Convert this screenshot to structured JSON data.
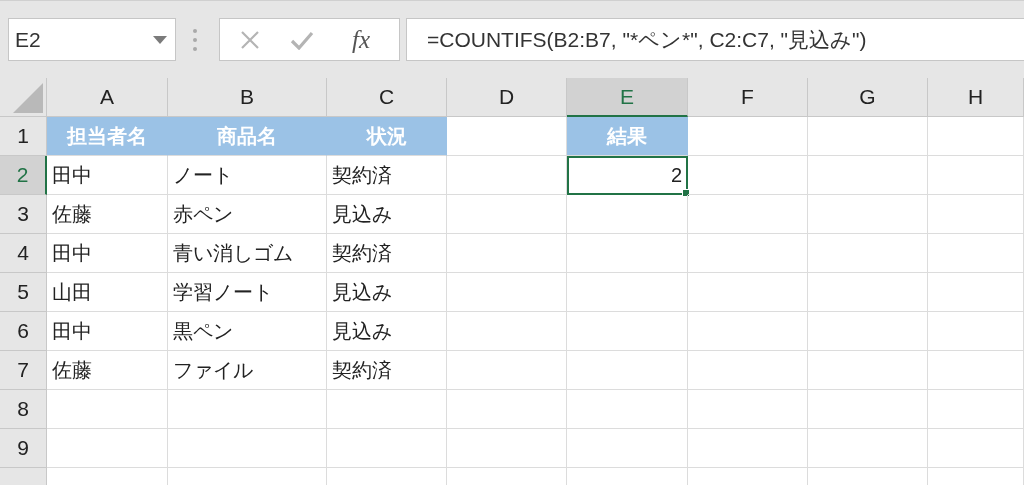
{
  "name_box": {
    "value": "E2"
  },
  "formula_bar": {
    "insert_function_label": "fx",
    "value": "=COUNTIFS(B2:B7, \"*ペン*\", C2:C7, \"見込み\")"
  },
  "columns": [
    {
      "label": "A",
      "selected": false
    },
    {
      "label": "B",
      "selected": false
    },
    {
      "label": "C",
      "selected": false
    },
    {
      "label": "D",
      "selected": false
    },
    {
      "label": "E",
      "selected": true
    },
    {
      "label": "F",
      "selected": false
    },
    {
      "label": "G",
      "selected": false
    },
    {
      "label": "H",
      "selected": false
    }
  ],
  "row_headers": [
    {
      "label": "1",
      "selected": false
    },
    {
      "label": "2",
      "selected": true
    },
    {
      "label": "3",
      "selected": false
    },
    {
      "label": "4",
      "selected": false
    },
    {
      "label": "5",
      "selected": false
    },
    {
      "label": "6",
      "selected": false
    },
    {
      "label": "7",
      "selected": false
    },
    {
      "label": "8",
      "selected": false
    },
    {
      "label": "9",
      "selected": false
    }
  ],
  "data_table": {
    "headers": [
      "担当者名",
      "商品名",
      "状況"
    ],
    "rows": [
      [
        "田中",
        "ノート",
        "契約済"
      ],
      [
        "佐藤",
        "赤ペン",
        "見込み"
      ],
      [
        "田中",
        "青い消しゴム",
        "契約済"
      ],
      [
        "山田",
        "学習ノート",
        "見込み"
      ],
      [
        "田中",
        "黒ペン",
        "見込み"
      ],
      [
        "佐藤",
        "ファイル",
        "契約済"
      ]
    ]
  },
  "result": {
    "header": "結果",
    "value": "2",
    "selected": true
  }
}
